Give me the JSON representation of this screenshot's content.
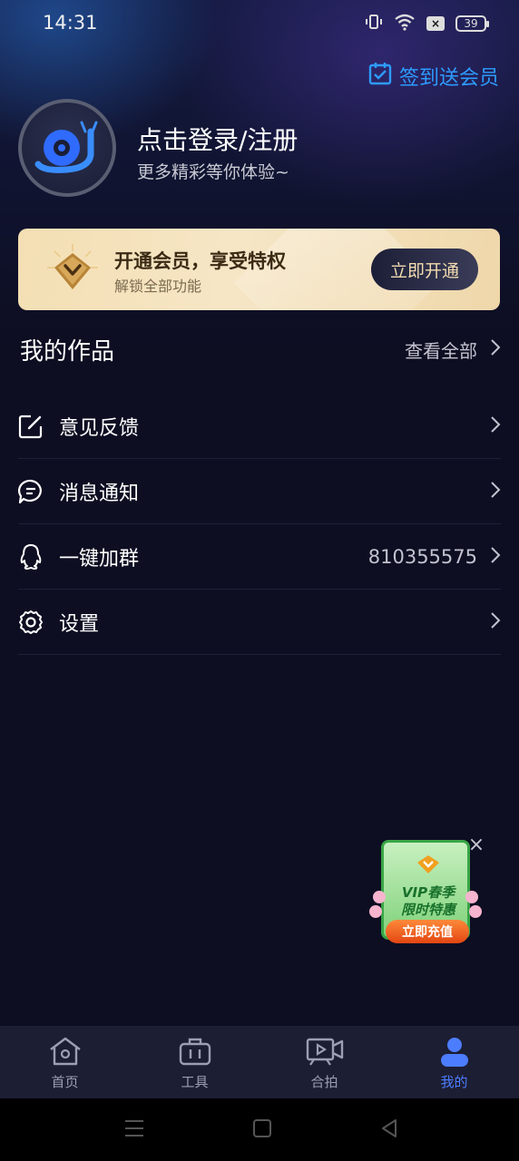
{
  "status_bar": {
    "time": "14:31",
    "battery": "39"
  },
  "header": {
    "signin_label": "签到送会员"
  },
  "profile": {
    "title": "点击登录/注册",
    "subtitle": "更多精彩等你体验~"
  },
  "vip_banner": {
    "title": "开通会员，享受特权",
    "subtitle": "解锁全部功能",
    "button": "立即开通"
  },
  "works": {
    "title": "我的作品",
    "view_all": "查看全部"
  },
  "menu": [
    {
      "label": "意见反馈",
      "icon": "edit-icon"
    },
    {
      "label": "消息通知",
      "icon": "message-icon"
    },
    {
      "label": "一键加群",
      "icon": "qq-icon",
      "value": "810355575"
    },
    {
      "label": "设置",
      "icon": "gear-icon"
    }
  ],
  "promo": {
    "line1": "VIP春季",
    "line2": "限时特惠",
    "button": "立即充值"
  },
  "tabs": [
    {
      "label": "首页",
      "icon": "home-icon"
    },
    {
      "label": "工具",
      "icon": "toolbox-icon"
    },
    {
      "label": "合拍",
      "icon": "video-icon"
    },
    {
      "label": "我的",
      "icon": "user-icon",
      "active": true
    }
  ],
  "colors": {
    "accent": "#4d7dff",
    "signin": "#2e9bff",
    "background": "#0d0e22",
    "vip_gold": "#f4dfb3"
  }
}
